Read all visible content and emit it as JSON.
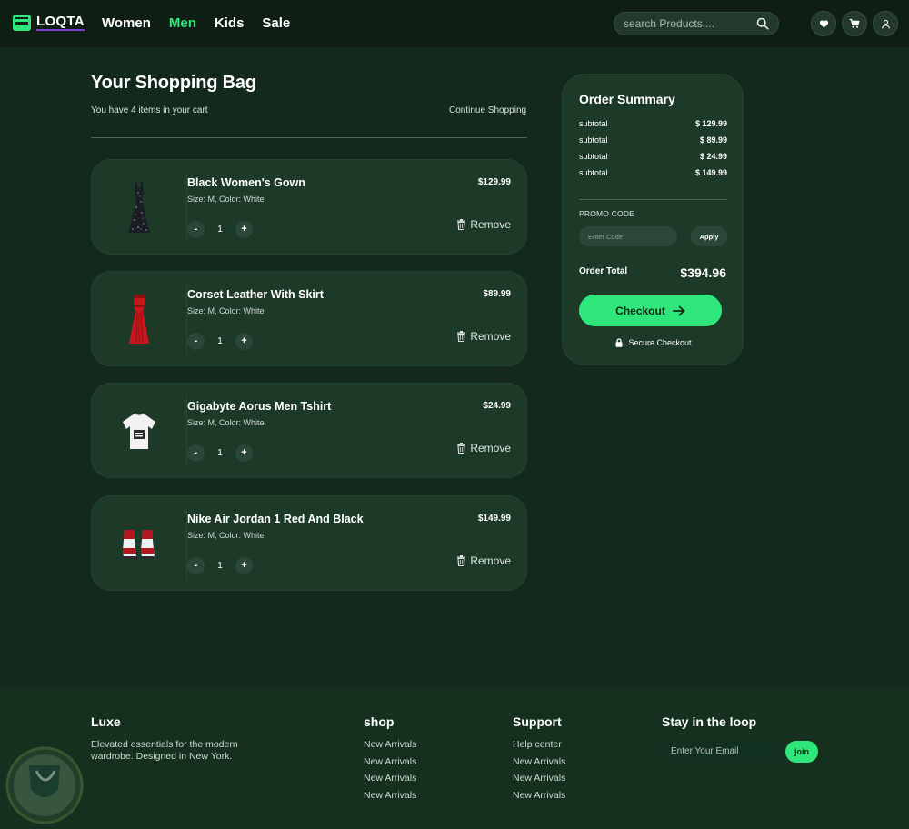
{
  "brand": {
    "name": "LOQTA"
  },
  "nav": {
    "items": [
      {
        "label": "Women",
        "active": false
      },
      {
        "label": "Men",
        "active": true
      },
      {
        "label": "Kids",
        "active": false
      },
      {
        "label": "Sale",
        "active": false
      }
    ]
  },
  "search": {
    "placeholder": "search Products...."
  },
  "header_icons": [
    "heart-icon",
    "cart-icon",
    "user-icon"
  ],
  "cart": {
    "title": "Your Shopping Bag",
    "subtitle": "You have 4 items in your cart",
    "continue_label": "Continue Shopping",
    "remove_label": "Remove",
    "qty_minus": "-",
    "qty_plus": "+",
    "items": [
      {
        "name": "Black Women's Gown",
        "attributes": "Size: M, Color: White",
        "price": "$129.99",
        "quantity": "1",
        "image": "black-gown"
      },
      {
        "name": "Corset Leather With Skirt",
        "attributes": "Size: M, Color: White",
        "price": "$89.99",
        "quantity": "1",
        "image": "red-dress"
      },
      {
        "name": "Gigabyte Aorus Men Tshirt",
        "attributes": "Size: M, Color: White",
        "price": "$24.99",
        "quantity": "1",
        "image": "white-tshirt"
      },
      {
        "name": "Nike Air Jordan 1 Red And Black",
        "attributes": "Size: M, Color: White",
        "price": "$149.99",
        "quantity": "1",
        "image": "red-sneakers"
      }
    ]
  },
  "summary": {
    "title": "Order Summary",
    "rows": [
      {
        "label": "subtotal",
        "value": "$ 129.99"
      },
      {
        "label": "subtotal",
        "value": "$ 89.99"
      },
      {
        "label": "subtotal",
        "value": "$ 24.99"
      },
      {
        "label": "subtotal",
        "value": "$ 149.99"
      }
    ],
    "promo_label": "PROMO CODE",
    "promo_placeholder": "Enter Code",
    "apply_label": "Apply",
    "total_label": "Order Total",
    "total_value": "$394.96",
    "checkout_label": "Checkout",
    "secure_label": "Secure Checkout"
  },
  "footer": {
    "brand": "Luxe",
    "tagline": "Elevated essentials for the modern wardrobe. Designed in New York.",
    "shop": {
      "heading": "shop",
      "links": [
        "New Arrivals",
        "New Arrivals",
        "New Arrivals",
        "New Arrivals"
      ]
    },
    "support": {
      "heading": "Support",
      "links": [
        "Help center",
        "New Arrivals",
        "New Arrivals",
        "New Arrivals"
      ]
    },
    "newsletter": {
      "heading": "Stay in the loop",
      "placeholder": "Enter Your Email",
      "button_label": "join"
    }
  },
  "colors": {
    "accent": "#2ee67a",
    "background": "#13291d",
    "card": "#1d3a29",
    "header": "#0f1e15",
    "footer": "#15301f"
  }
}
